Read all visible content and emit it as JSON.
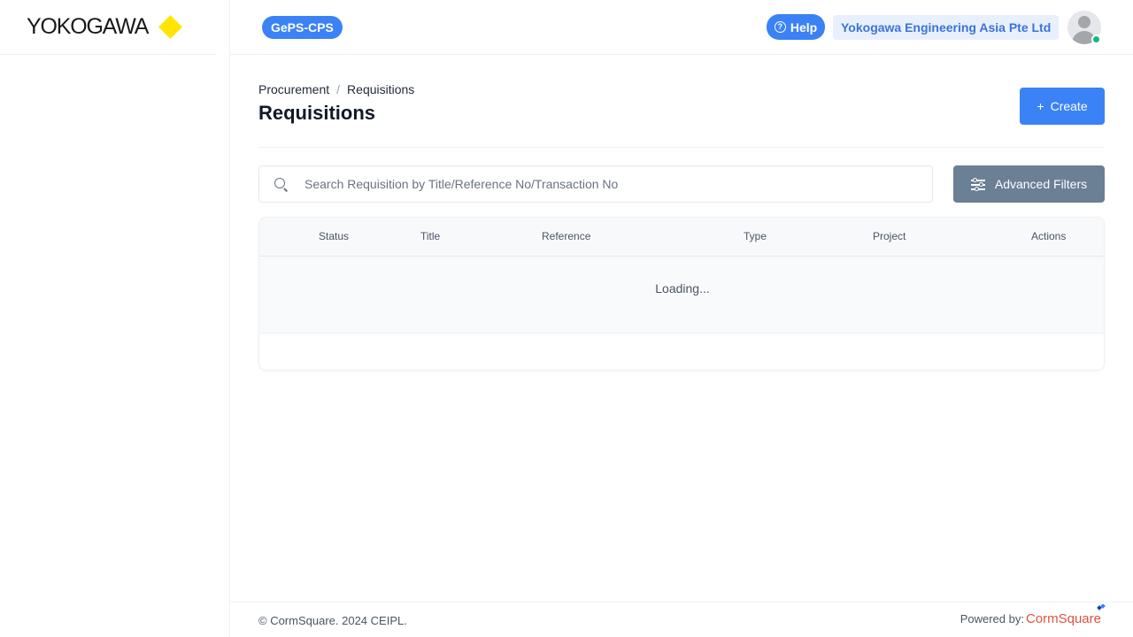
{
  "brand": {
    "logo_text": "YOKOGAWA",
    "accent_color": "#ffe500"
  },
  "header": {
    "app_badge": "GePS-CPS",
    "help_label": "Help",
    "company": "Yokogawa Engineering Asia Pte Ltd",
    "avatar_icon": "user-avatar",
    "status": "online"
  },
  "page": {
    "breadcrumb": [
      "Procurement",
      "/",
      "Requisitions"
    ],
    "title": "Requisitions",
    "create_label": "Create"
  },
  "search": {
    "placeholder": "Search Requisition by Title/Reference No/Transaction No",
    "value": ""
  },
  "filters": {
    "label": "Advanced Filters"
  },
  "table": {
    "columns": [
      "Status",
      "Title",
      "Reference",
      "Type",
      "Project",
      "Actions"
    ],
    "loading_text": "Loading..."
  },
  "footer": {
    "copyright": "© CormSquare. 2024 CEIPL.",
    "powered_label": "Powered by:",
    "powered_brand": "CormSquare"
  },
  "colors": {
    "primary": "#3b82f6",
    "secondary": "#6b7f95",
    "online": "#10b981"
  }
}
